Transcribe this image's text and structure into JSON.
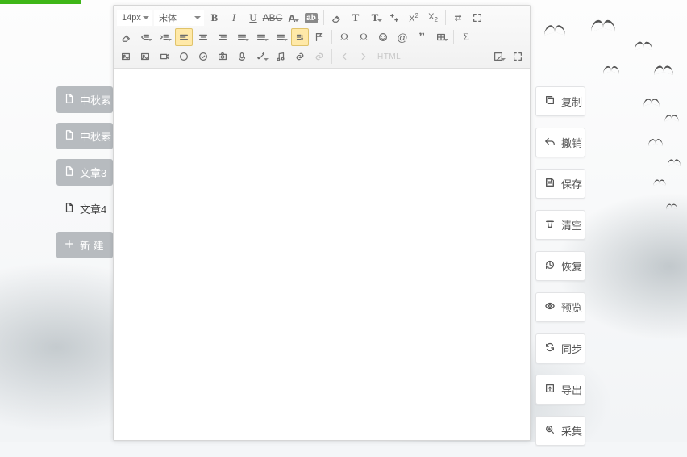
{
  "toolbar": {
    "fontSize": "14px",
    "fontFamily": "宋体"
  },
  "leftDocs": [
    {
      "label": "中秋素",
      "active": true
    },
    {
      "label": "中秋素",
      "active": true
    },
    {
      "label": "文章3",
      "active": true
    },
    {
      "label": "文章4",
      "active": false
    }
  ],
  "newButtonLabel": "新 建",
  "rightActions": [
    {
      "name": "copy",
      "label": "复制",
      "icon": "copy"
    },
    {
      "name": "undo",
      "label": "撤销",
      "icon": "undo"
    },
    {
      "name": "save",
      "label": "保存",
      "icon": "save"
    },
    {
      "name": "clear",
      "label": "清空",
      "icon": "trash"
    },
    {
      "name": "restore",
      "label": "恢复",
      "icon": "history"
    },
    {
      "name": "preview",
      "label": "预览",
      "icon": "eye"
    },
    {
      "name": "sync",
      "label": "同步",
      "icon": "sync"
    },
    {
      "name": "export",
      "label": "导出",
      "icon": "export"
    },
    {
      "name": "collect",
      "label": "采集",
      "icon": "zoom"
    }
  ],
  "htmlBtnLabel": "HTML",
  "toolbarRows": [
    [
      "bold",
      "italic",
      "underline",
      "strike",
      "fontcolor",
      "bgcolor",
      "sep",
      "clearfmt",
      "textsize",
      "textsize-dd",
      "compress",
      "super",
      "sub",
      "sep",
      "undo2",
      "redo2"
    ],
    [
      "eraser",
      "outdent-dd",
      "indent-dd",
      "align-l-active",
      "align-c",
      "align-r",
      "align-j-dd",
      "lineheight-dd",
      "spacing-dd",
      "dir-active",
      "flag",
      "sep",
      "omega",
      "omega2",
      "smile",
      "at",
      "quote",
      "table-dd",
      "sep",
      "sigma"
    ],
    [
      "image",
      "image2",
      "video",
      "circle",
      "checkcircle",
      "camera",
      "mic",
      "wand-dd",
      "music",
      "link",
      "unlink",
      "sep",
      "undo3",
      "redo3",
      "html",
      "spacer",
      "formpaint-dd",
      "fullscreen"
    ]
  ]
}
